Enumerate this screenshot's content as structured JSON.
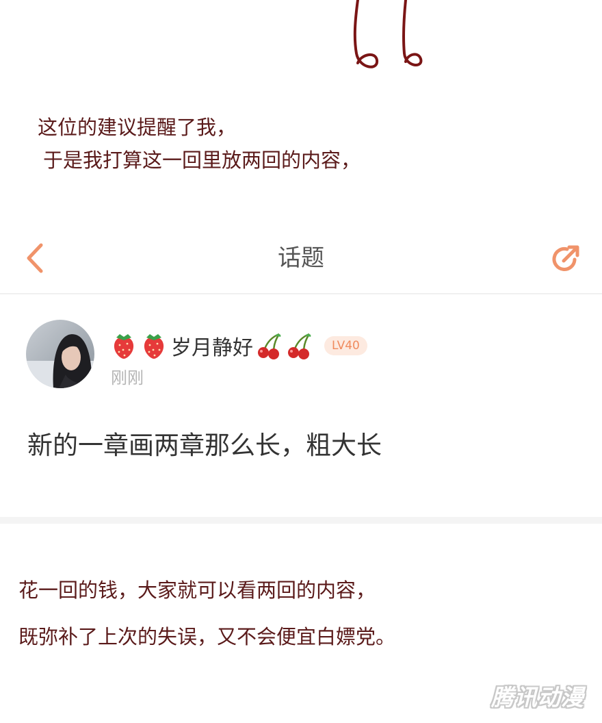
{
  "comic_panel": {
    "caption_lines": [
      "这位的建议提醒了我，",
      "于是我打算这一回里放两回的内容，"
    ],
    "text_color": "#5a1a1a"
  },
  "nav": {
    "back_icon": "chevron-left-icon",
    "title": "话题",
    "share_icon": "share-icon",
    "accent_color": "#f0936a"
  },
  "post": {
    "avatar_icon": "user-avatar-photo",
    "username": "岁月静好",
    "username_emojis_before": [
      "strawberry",
      "strawberry"
    ],
    "username_emojis_after": [
      "cherry",
      "cherry"
    ],
    "level": "LV40",
    "time": "刚刚",
    "content": "新的一章画两章那么长，粗大长"
  },
  "caption_bottom": {
    "lines": [
      "花一回的钱，大家就可以看两回的内容，",
      "既弥补了上次的失误，又不会便宜白嫖党。"
    ]
  },
  "watermark": {
    "text": "腾讯动漫"
  }
}
